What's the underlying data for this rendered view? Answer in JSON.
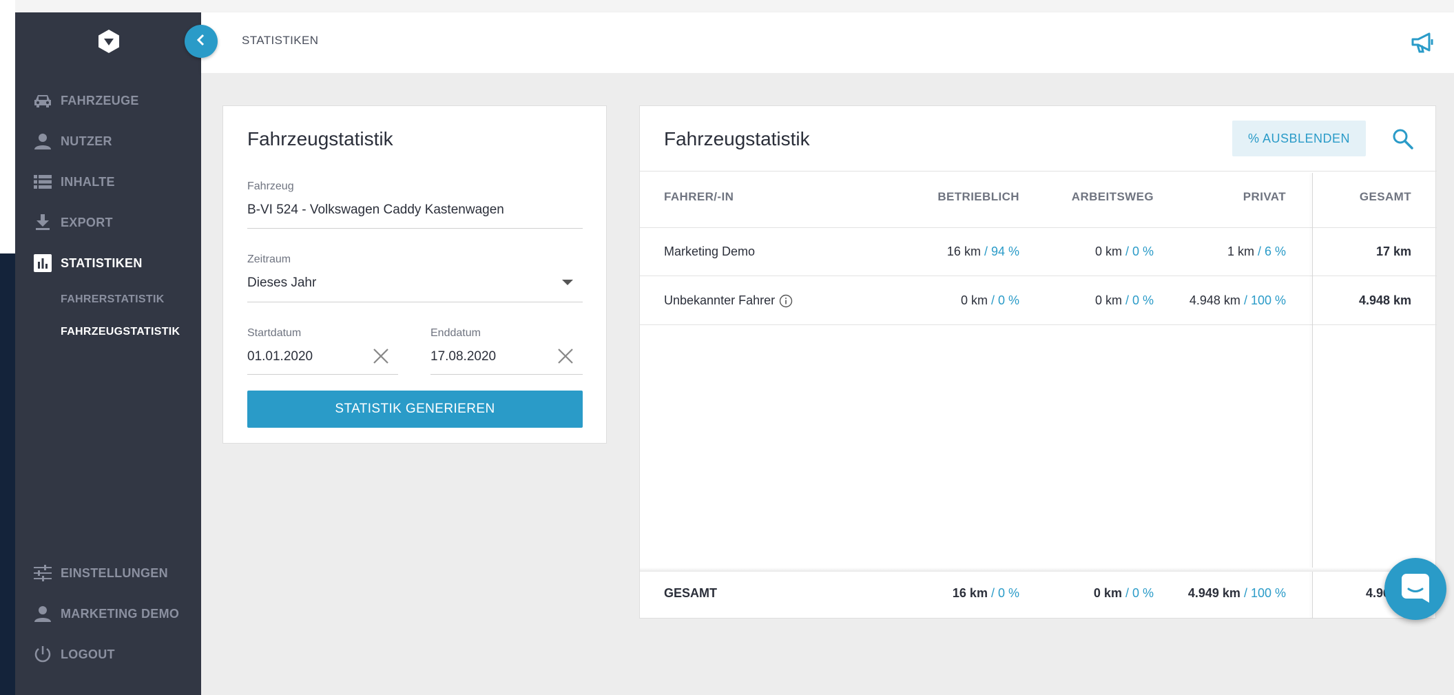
{
  "header": {
    "title": "STATISTIKEN"
  },
  "sidebar": {
    "items": [
      {
        "label": "FAHRZEUGE",
        "icon": "car-icon"
      },
      {
        "label": "NUTZER",
        "icon": "person-icon"
      },
      {
        "label": "INHALTE",
        "icon": "list-icon"
      },
      {
        "label": "EXPORT",
        "icon": "download-icon"
      },
      {
        "label": "STATISTIKEN",
        "icon": "bar-chart-icon",
        "active": true
      }
    ],
    "subitems": [
      {
        "label": "FAHRERSTATISTIK"
      },
      {
        "label": "FAHRZEUGSTATISTIK",
        "active": true
      }
    ],
    "bottom_items": [
      {
        "label": "EINSTELLUNGEN",
        "icon": "sliders-icon"
      },
      {
        "label": "MARKETING DEMO",
        "icon": "person-icon"
      },
      {
        "label": "LOGOUT",
        "icon": "power-icon"
      }
    ]
  },
  "form": {
    "title": "Fahrzeugstatistik",
    "vehicle": {
      "label": "Fahrzeug",
      "value": "B-VI 524 - Volkswagen Caddy Kastenwagen"
    },
    "period": {
      "label": "Zeitraum",
      "value": "Dieses Jahr"
    },
    "start": {
      "label": "Startdatum",
      "value": "01.01.2020"
    },
    "end": {
      "label": "Enddatum",
      "value": "17.08.2020"
    },
    "generate_label": "STATISTIK GENERIEREN"
  },
  "table": {
    "title": "Fahrzeugstatistik",
    "hide_pct_label": "% AUSBLENDEN",
    "columns": [
      "FAHRER/-IN",
      "BETRIEBLICH",
      "ARBEITSWEG",
      "PRIVAT",
      "GESAMT"
    ],
    "rows": [
      {
        "driver": "Marketing Demo",
        "business_km": "16 km",
        "business_pct": "/ 94 %",
        "commute_km": "0 km",
        "commute_pct": "/ 0 %",
        "private_km": "1 km",
        "private_pct": "/ 6 %",
        "total": "17 km"
      },
      {
        "driver": "Unbekannter Fahrer",
        "business_km": "0 km",
        "business_pct": "/ 0 %",
        "commute_km": "0 km",
        "commute_pct": "/ 0 %",
        "private_km": "4.948 km",
        "private_pct": "/ 100 %",
        "total": "4.948 km"
      }
    ],
    "footer": {
      "label": "GESAMT",
      "business_km": "16 km",
      "business_pct": "/ 0 %",
      "commute_km": "0 km",
      "commute_pct": "/ 0 %",
      "private_km": "4.949 km",
      "private_pct": "/ 100 %",
      "total": "4.96"
    }
  },
  "colors": {
    "accent": "#2a9bc8",
    "sidebar": "#323744",
    "background": "#ededed"
  }
}
